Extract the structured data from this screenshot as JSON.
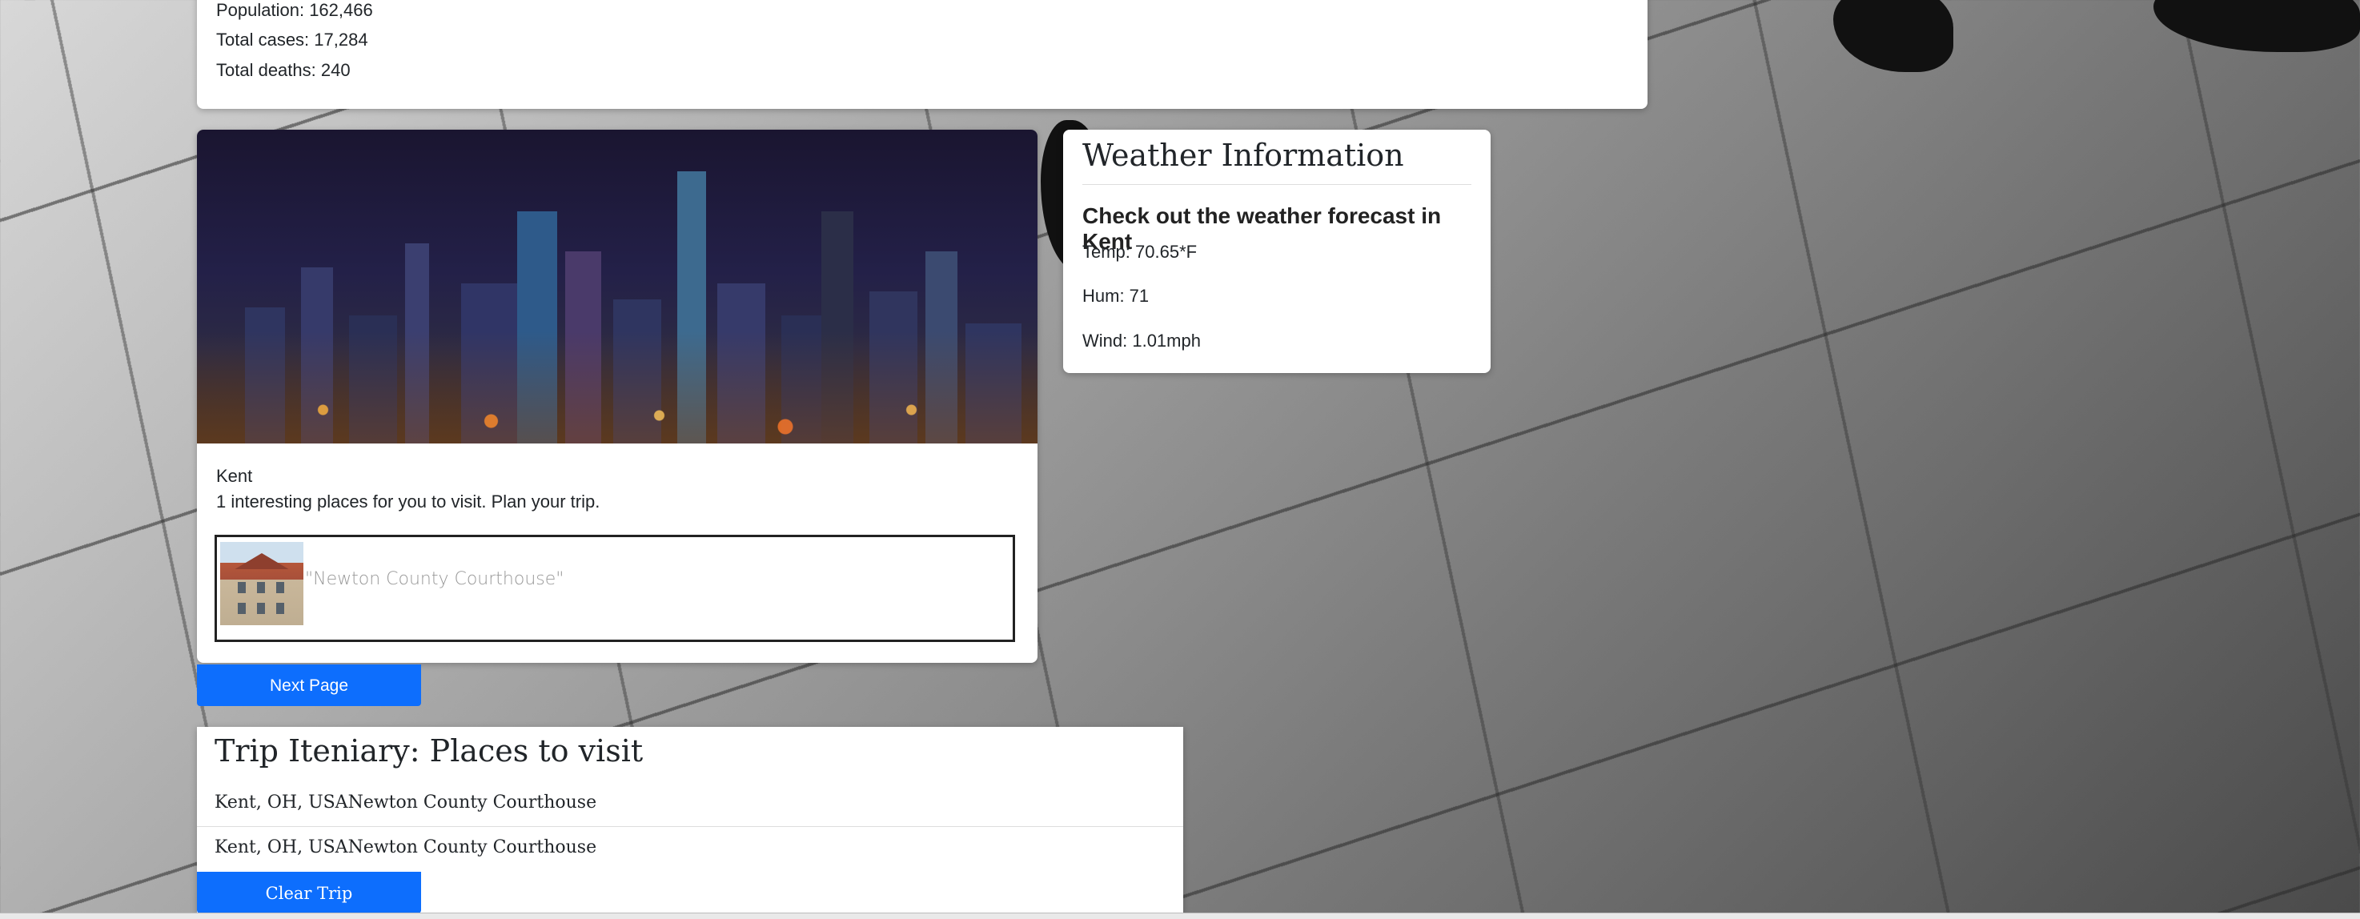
{
  "stats": {
    "population": "Population: 162,466",
    "cases": "Total cases: 17,284",
    "deaths": "Total deaths: 240"
  },
  "city": {
    "name": "Kent",
    "description": "1 interesting places for you to visit. Plan your trip.",
    "places": [
      {
        "name": "\"Newton County Courthouse\""
      }
    ],
    "next_button": "Next Page"
  },
  "weather": {
    "title": "Weather Information",
    "subtitle": "Check out the weather forecast in Kent",
    "temp": "Temp: 70.65*F",
    "hum": "Hum: 71",
    "wind": "Wind: 1.01mph"
  },
  "trip": {
    "title": "Trip Iteniary: Places to visit",
    "items": [
      "Kent, OH, USANewton County Courthouse",
      "Kent, OH, USANewton County Courthouse"
    ],
    "clear_button": "Clear Trip"
  },
  "colors": {
    "primary_button": "#0d6efd"
  }
}
